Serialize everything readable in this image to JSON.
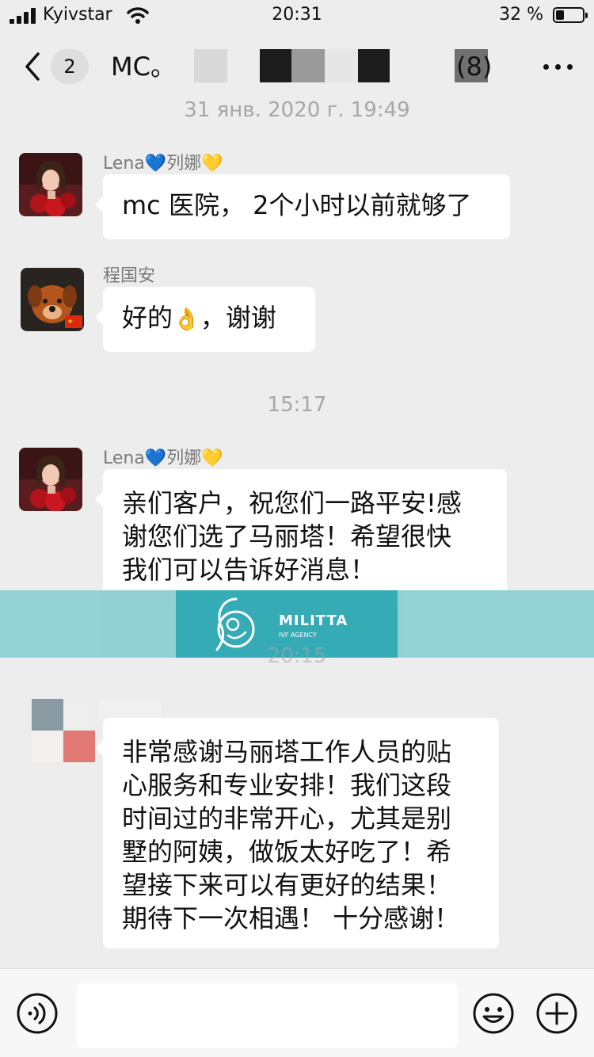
{
  "status_bar": {
    "carrier": "Kyivstar",
    "time": "20:31",
    "battery_percent": "32 %",
    "battery_level": 0.32
  },
  "nav": {
    "back_label": "",
    "unread_count": "2",
    "title": "MC。",
    "member_count": "(8)"
  },
  "messages": [
    {
      "type": "timestamp",
      "text": "31 янв. 2020 г. 19:49"
    },
    {
      "type": "message",
      "sender": "Lena",
      "sender_suffix": "列娜",
      "text": "mc 医院， 2个小时以前就够了"
    },
    {
      "type": "message",
      "sender": "程国安",
      "text_before": "好的",
      "emoji": "👌",
      "text_after": "，谢谢"
    },
    {
      "type": "timestamp",
      "text": "15:17"
    },
    {
      "type": "message",
      "sender": "Lena",
      "sender_suffix": "列娜",
      "lines": [
        "亲们客户，祝您们一路平安!感",
        "谢您们选了马丽塔！希望很快",
        "我们可以告诉好消息！"
      ]
    },
    {
      "type": "timestamp",
      "text": "20:15"
    },
    {
      "type": "message",
      "sender": "",
      "lines": [
        "非常感谢马丽塔工作人员的贴",
        "心服务和专业安排！我们这段",
        "时间过的非常开心，尤其是别",
        "墅的阿姨，做饭太好吃了！希",
        "望接下来可以有更好的结果！",
        "期待下一次相遇！ 十分感谢！"
      ]
    }
  ],
  "watermark": {
    "name": "MILITTA",
    "sub": "IVF AGENCY"
  },
  "input": {
    "placeholder": ""
  }
}
